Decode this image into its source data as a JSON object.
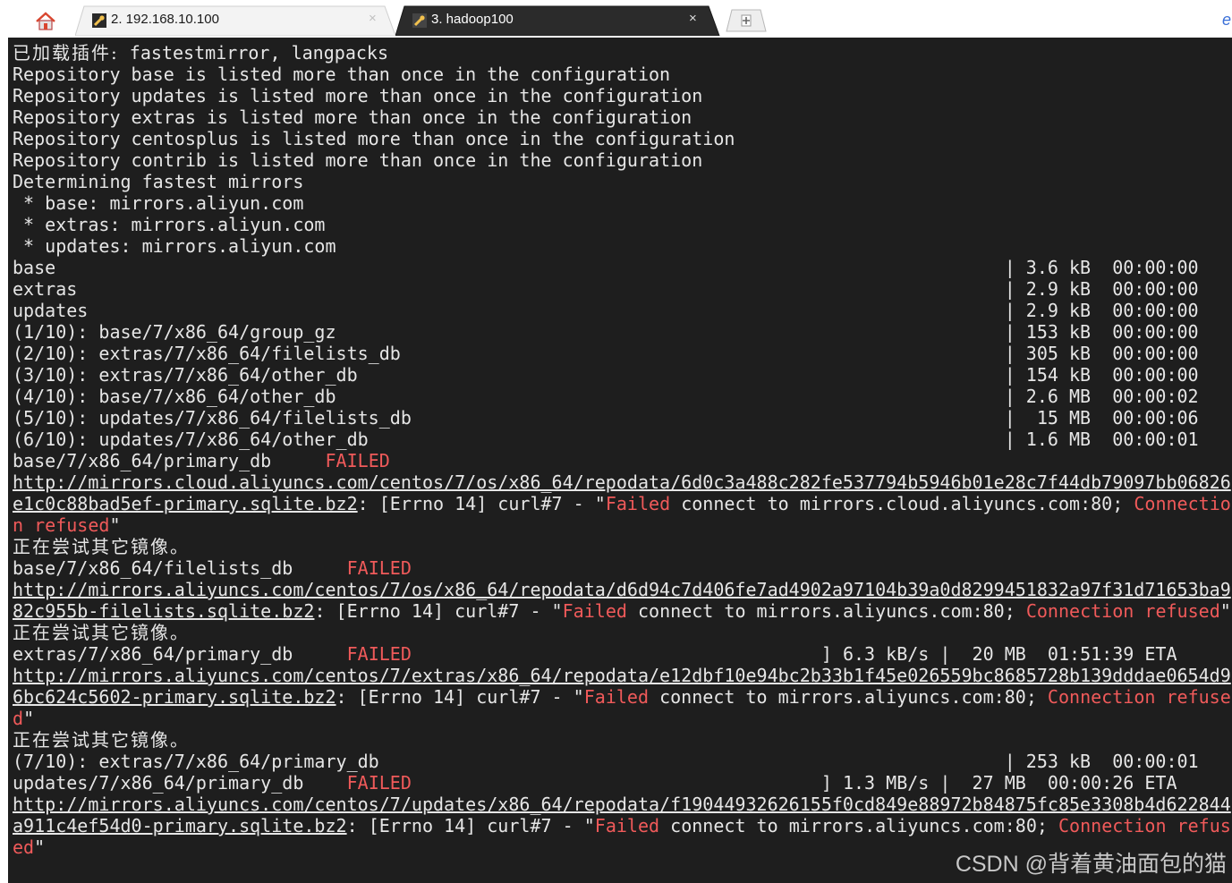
{
  "tabs": [
    {
      "label": "2. 192.168.10.100",
      "close": "×",
      "active": false
    },
    {
      "label": "3. hadoop100",
      "close": "×",
      "active": true
    }
  ],
  "new_tab_icon": "plus-icon",
  "colors": {
    "terminal_bg": "#1e1e1e",
    "text": "#e6e6e6",
    "error": "#f05a5a",
    "active_tab": "#2b2b2b"
  },
  "terminal": {
    "lines": [
      [
        "已加载插件:",
        " fastestmirror, langpacks"
      ],
      [
        "Repository base is listed more than once in the configuration"
      ],
      [
        "Repository updates is listed more than once in the configuration"
      ],
      [
        "Repository extras is listed more than once in the configuration"
      ],
      [
        "Repository centosplus is listed more than once in the configuration"
      ],
      [
        "Repository contrib is listed more than once in the configuration"
      ],
      [
        "Determining fastest mirrors"
      ],
      [
        " * base: mirrors.aliyun.com"
      ],
      [
        " * extras: mirrors.aliyun.com"
      ],
      [
        " * updates: mirrors.aliyun.com"
      ],
      [
        "base                                                                                        | 3.6 kB  00:00:00"
      ],
      [
        "extras                                                                                      | 2.9 kB  00:00:00"
      ],
      [
        "updates                                                                                     | 2.9 kB  00:00:00"
      ],
      [
        "(1/10): base/7/x86_64/group_gz                                                              | 153 kB  00:00:00"
      ],
      [
        "(2/10): extras/7/x86_64/filelists_db                                                        | 305 kB  00:00:00"
      ],
      [
        "(3/10): extras/7/x86_64/other_db                                                            | 154 kB  00:00:00"
      ],
      [
        "(4/10): base/7/x86_64/other_db                                                              | 2.6 MB  00:00:02"
      ],
      [
        "(5/10): updates/7/x86_64/filelists_db                                                       |  15 MB  00:00:06"
      ],
      [
        "(6/10): updates/7/x86_64/other_db                                                           | 1.6 MB  00:00:01"
      ],
      [
        "base/7/x86_64/primary_db     ",
        "FAILED"
      ],
      [
        "http://mirrors.cloud.aliyuncs.com/centos/7/os/x86_64/repodata/6d0c3a488c282fe537794b5946b01e28c7f44db79097bb06826"
      ],
      [
        "e1c0c88bad5ef-primary.sqlite.bz2",
        ": [Errno 14] curl#7 - \"",
        "Failed",
        " connect to mirrors.cloud.aliyuncs.com:80; ",
        "Connectio"
      ],
      [
        "n refused",
        "\""
      ],
      [
        "正在尝试其它镜像。"
      ],
      [
        "base/7/x86_64/filelists_db     ",
        "FAILED"
      ],
      [
        "http://mirrors.aliyuncs.com/centos/7/os/x86_64/repodata/d6d94c7d406fe7ad4902a97104b39a0d8299451832a97f31d71653ba9"
      ],
      [
        "82c955b-filelists.sqlite.bz2",
        ": [Errno 14] curl#7 - \"",
        "Failed",
        " connect to mirrors.aliyuncs.com:80; ",
        "Connection refused",
        "\""
      ],
      [
        "正在尝试其它镜像。"
      ],
      [
        "extras/7/x86_64/primary_db     ",
        "FAILED",
        "                                      ] 6.3 kB/s |  20 MB  01:51:39 ETA"
      ],
      [
        "http://mirrors.aliyuncs.com/centos/7/extras/x86_64/repodata/e12dbf10e94bc2b33b1f45e026559bc8685728b139dddae0654d9"
      ],
      [
        "6bc624c5602-primary.sqlite.bz2",
        ": [Errno 14] curl#7 - \"",
        "Failed",
        " connect to mirrors.aliyuncs.com:80; ",
        "Connection refuse"
      ],
      [
        "d",
        "\""
      ],
      [
        "正在尝试其它镜像。"
      ],
      [
        "(7/10): extras/7/x86_64/primary_db                                                          | 253 kB  00:00:01"
      ],
      [
        "updates/7/x86_64/primary_db    ",
        "FAILED",
        "                                      ] 1.3 MB/s |  27 MB  00:00:26 ETA"
      ],
      [
        "http://mirrors.aliyuncs.com/centos/7/updates/x86_64/repodata/f19044932626155f0cd849e88972b84875fc85e3308b4d622844"
      ],
      [
        "a911c4ef54d0-primary.sqlite.bz2",
        ": [Errno 14] curl#7 - \"",
        "Failed",
        " connect to mirrors.aliyuncs.com:80; ",
        "Connection refus"
      ],
      [
        "ed",
        "\""
      ]
    ]
  },
  "watermark": "CSDN @背着黄油面包的猫"
}
